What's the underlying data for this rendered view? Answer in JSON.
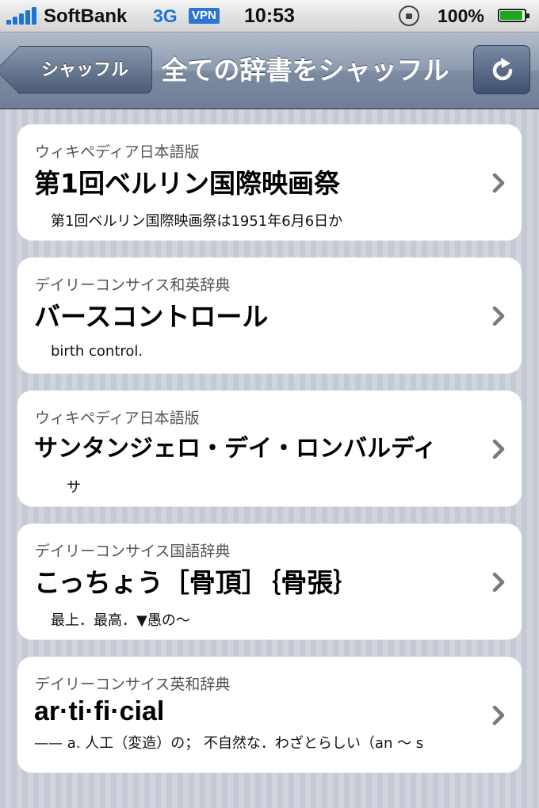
{
  "status_bar": {
    "carrier": "SoftBank",
    "network": "3G",
    "vpn": "VPN",
    "time": "10:53",
    "battery": "100%",
    "battery_level": 1.0
  },
  "nav_bar": {
    "back_label": "シャッフル",
    "title": "全ての辞書をシャッフル",
    "refresh_icon": "refresh-icon"
  },
  "entries": [
    {
      "source": "ウィキペディア日本語版",
      "headword": "第1回ベルリン国際映画祭",
      "excerpt": "第1回ベルリン国際映画祭は1951年6月6日か"
    },
    {
      "source": "デイリーコンサイス和英辞典",
      "headword": "バースコントロール",
      "excerpt": "birth control."
    },
    {
      "source": "ウィキペディア日本語版",
      "headword": "サンタンジェロ・デイ・ロンバルディ",
      "excerpt": "サ"
    },
    {
      "source": "デイリーコンサイス国語辞典",
      "headword": "こっちょう［骨頂］｛骨張｝",
      "excerpt": "最上．最高．▼愚の～"
    },
    {
      "source": "デイリーコンサイス英和辞典",
      "headword": "ar·ti·fi·cial",
      "excerpt": "—— a. 人工（変造）の； 不自然な．わざとらしい（an ～ s"
    }
  ],
  "colors": {
    "accent": "#1d74d6",
    "nav": "#7d8ba2",
    "battery": "#1fa61f"
  }
}
